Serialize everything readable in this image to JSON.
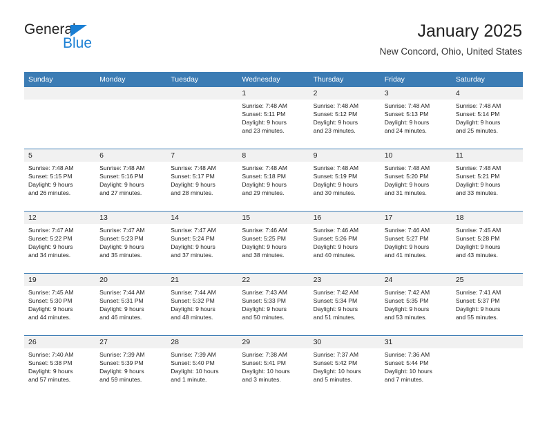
{
  "brand": {
    "name_top": "General",
    "name_bottom": "Blue"
  },
  "header": {
    "title": "January 2025",
    "subtitle": "New Concord, Ohio, United States"
  },
  "colors": {
    "header_blue": "#3c7cb4",
    "brand_blue": "#1a7fd4",
    "daynum_band": "#f1f1f1",
    "text": "#222222"
  },
  "weekdays": [
    "Sunday",
    "Monday",
    "Tuesday",
    "Wednesday",
    "Thursday",
    "Friday",
    "Saturday"
  ],
  "labels": {
    "sunrise_prefix": "Sunrise:",
    "sunset_prefix": "Sunset:",
    "daylight_prefix": "Daylight:"
  },
  "weeks": [
    [
      {
        "day": "",
        "empty": true,
        "l1": "",
        "l2": "",
        "l3": "",
        "l4": ""
      },
      {
        "day": "",
        "empty": true,
        "l1": "",
        "l2": "",
        "l3": "",
        "l4": ""
      },
      {
        "day": "",
        "empty": true,
        "l1": "",
        "l2": "",
        "l3": "",
        "l4": ""
      },
      {
        "day": "1",
        "empty": false,
        "l1": "Sunrise: 7:48 AM",
        "l2": "Sunset: 5:11 PM",
        "l3": "Daylight: 9 hours",
        "l4": "and 23 minutes."
      },
      {
        "day": "2",
        "empty": false,
        "l1": "Sunrise: 7:48 AM",
        "l2": "Sunset: 5:12 PM",
        "l3": "Daylight: 9 hours",
        "l4": "and 23 minutes."
      },
      {
        "day": "3",
        "empty": false,
        "l1": "Sunrise: 7:48 AM",
        "l2": "Sunset: 5:13 PM",
        "l3": "Daylight: 9 hours",
        "l4": "and 24 minutes."
      },
      {
        "day": "4",
        "empty": false,
        "l1": "Sunrise: 7:48 AM",
        "l2": "Sunset: 5:14 PM",
        "l3": "Daylight: 9 hours",
        "l4": "and 25 minutes."
      }
    ],
    [
      {
        "day": "5",
        "empty": false,
        "l1": "Sunrise: 7:48 AM",
        "l2": "Sunset: 5:15 PM",
        "l3": "Daylight: 9 hours",
        "l4": "and 26 minutes."
      },
      {
        "day": "6",
        "empty": false,
        "l1": "Sunrise: 7:48 AM",
        "l2": "Sunset: 5:16 PM",
        "l3": "Daylight: 9 hours",
        "l4": "and 27 minutes."
      },
      {
        "day": "7",
        "empty": false,
        "l1": "Sunrise: 7:48 AM",
        "l2": "Sunset: 5:17 PM",
        "l3": "Daylight: 9 hours",
        "l4": "and 28 minutes."
      },
      {
        "day": "8",
        "empty": false,
        "l1": "Sunrise: 7:48 AM",
        "l2": "Sunset: 5:18 PM",
        "l3": "Daylight: 9 hours",
        "l4": "and 29 minutes."
      },
      {
        "day": "9",
        "empty": false,
        "l1": "Sunrise: 7:48 AM",
        "l2": "Sunset: 5:19 PM",
        "l3": "Daylight: 9 hours",
        "l4": "and 30 minutes."
      },
      {
        "day": "10",
        "empty": false,
        "l1": "Sunrise: 7:48 AM",
        "l2": "Sunset: 5:20 PM",
        "l3": "Daylight: 9 hours",
        "l4": "and 31 minutes."
      },
      {
        "day": "11",
        "empty": false,
        "l1": "Sunrise: 7:48 AM",
        "l2": "Sunset: 5:21 PM",
        "l3": "Daylight: 9 hours",
        "l4": "and 33 minutes."
      }
    ],
    [
      {
        "day": "12",
        "empty": false,
        "l1": "Sunrise: 7:47 AM",
        "l2": "Sunset: 5:22 PM",
        "l3": "Daylight: 9 hours",
        "l4": "and 34 minutes."
      },
      {
        "day": "13",
        "empty": false,
        "l1": "Sunrise: 7:47 AM",
        "l2": "Sunset: 5:23 PM",
        "l3": "Daylight: 9 hours",
        "l4": "and 35 minutes."
      },
      {
        "day": "14",
        "empty": false,
        "l1": "Sunrise: 7:47 AM",
        "l2": "Sunset: 5:24 PM",
        "l3": "Daylight: 9 hours",
        "l4": "and 37 minutes."
      },
      {
        "day": "15",
        "empty": false,
        "l1": "Sunrise: 7:46 AM",
        "l2": "Sunset: 5:25 PM",
        "l3": "Daylight: 9 hours",
        "l4": "and 38 minutes."
      },
      {
        "day": "16",
        "empty": false,
        "l1": "Sunrise: 7:46 AM",
        "l2": "Sunset: 5:26 PM",
        "l3": "Daylight: 9 hours",
        "l4": "and 40 minutes."
      },
      {
        "day": "17",
        "empty": false,
        "l1": "Sunrise: 7:46 AM",
        "l2": "Sunset: 5:27 PM",
        "l3": "Daylight: 9 hours",
        "l4": "and 41 minutes."
      },
      {
        "day": "18",
        "empty": false,
        "l1": "Sunrise: 7:45 AM",
        "l2": "Sunset: 5:28 PM",
        "l3": "Daylight: 9 hours",
        "l4": "and 43 minutes."
      }
    ],
    [
      {
        "day": "19",
        "empty": false,
        "l1": "Sunrise: 7:45 AM",
        "l2": "Sunset: 5:30 PM",
        "l3": "Daylight: 9 hours",
        "l4": "and 44 minutes."
      },
      {
        "day": "20",
        "empty": false,
        "l1": "Sunrise: 7:44 AM",
        "l2": "Sunset: 5:31 PM",
        "l3": "Daylight: 9 hours",
        "l4": "and 46 minutes."
      },
      {
        "day": "21",
        "empty": false,
        "l1": "Sunrise: 7:44 AM",
        "l2": "Sunset: 5:32 PM",
        "l3": "Daylight: 9 hours",
        "l4": "and 48 minutes."
      },
      {
        "day": "22",
        "empty": false,
        "l1": "Sunrise: 7:43 AM",
        "l2": "Sunset: 5:33 PM",
        "l3": "Daylight: 9 hours",
        "l4": "and 50 minutes."
      },
      {
        "day": "23",
        "empty": false,
        "l1": "Sunrise: 7:42 AM",
        "l2": "Sunset: 5:34 PM",
        "l3": "Daylight: 9 hours",
        "l4": "and 51 minutes."
      },
      {
        "day": "24",
        "empty": false,
        "l1": "Sunrise: 7:42 AM",
        "l2": "Sunset: 5:35 PM",
        "l3": "Daylight: 9 hours",
        "l4": "and 53 minutes."
      },
      {
        "day": "25",
        "empty": false,
        "l1": "Sunrise: 7:41 AM",
        "l2": "Sunset: 5:37 PM",
        "l3": "Daylight: 9 hours",
        "l4": "and 55 minutes."
      }
    ],
    [
      {
        "day": "26",
        "empty": false,
        "l1": "Sunrise: 7:40 AM",
        "l2": "Sunset: 5:38 PM",
        "l3": "Daylight: 9 hours",
        "l4": "and 57 minutes."
      },
      {
        "day": "27",
        "empty": false,
        "l1": "Sunrise: 7:39 AM",
        "l2": "Sunset: 5:39 PM",
        "l3": "Daylight: 9 hours",
        "l4": "and 59 minutes."
      },
      {
        "day": "28",
        "empty": false,
        "l1": "Sunrise: 7:39 AM",
        "l2": "Sunset: 5:40 PM",
        "l3": "Daylight: 10 hours",
        "l4": "and 1 minute."
      },
      {
        "day": "29",
        "empty": false,
        "l1": "Sunrise: 7:38 AM",
        "l2": "Sunset: 5:41 PM",
        "l3": "Daylight: 10 hours",
        "l4": "and 3 minutes."
      },
      {
        "day": "30",
        "empty": false,
        "l1": "Sunrise: 7:37 AM",
        "l2": "Sunset: 5:42 PM",
        "l3": "Daylight: 10 hours",
        "l4": "and 5 minutes."
      },
      {
        "day": "31",
        "empty": false,
        "l1": "Sunrise: 7:36 AM",
        "l2": "Sunset: 5:44 PM",
        "l3": "Daylight: 10 hours",
        "l4": "and 7 minutes."
      },
      {
        "day": "",
        "empty": true,
        "l1": "",
        "l2": "",
        "l3": "",
        "l4": ""
      }
    ]
  ]
}
